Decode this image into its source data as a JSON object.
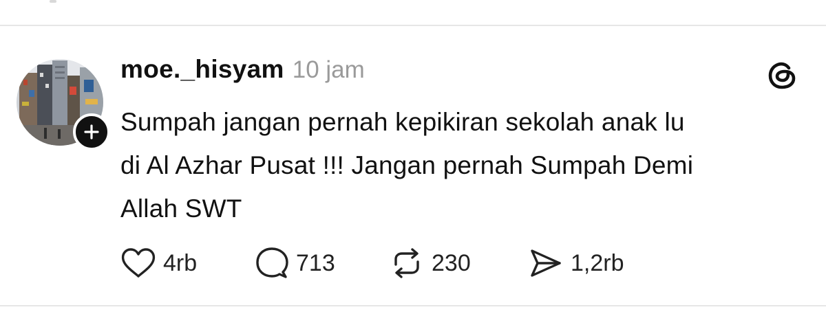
{
  "post": {
    "username": "moe._hisyam",
    "timestamp": "10 jam",
    "text_lines": [
      "Sumpah jangan pernah kepikiran sekolah anak lu",
      "di Al Azhar Pusat !!! Jangan pernah Sumpah Demi",
      "Allah SWT"
    ],
    "avatar_icon": "city-street-photo",
    "follow_icon": "plus-icon",
    "menu_icon": "threads-logo-icon"
  },
  "actions": {
    "like": {
      "icon": "heart-icon",
      "count": "4rb"
    },
    "reply": {
      "icon": "comment-icon",
      "count": "713"
    },
    "repost": {
      "icon": "repost-icon",
      "count": "230"
    },
    "share": {
      "icon": "send-icon",
      "count": "1,2rb"
    }
  },
  "colors": {
    "text": "#111111",
    "muted": "#9a9a9a",
    "divider": "#e6e6e6",
    "badge": "#111111"
  }
}
